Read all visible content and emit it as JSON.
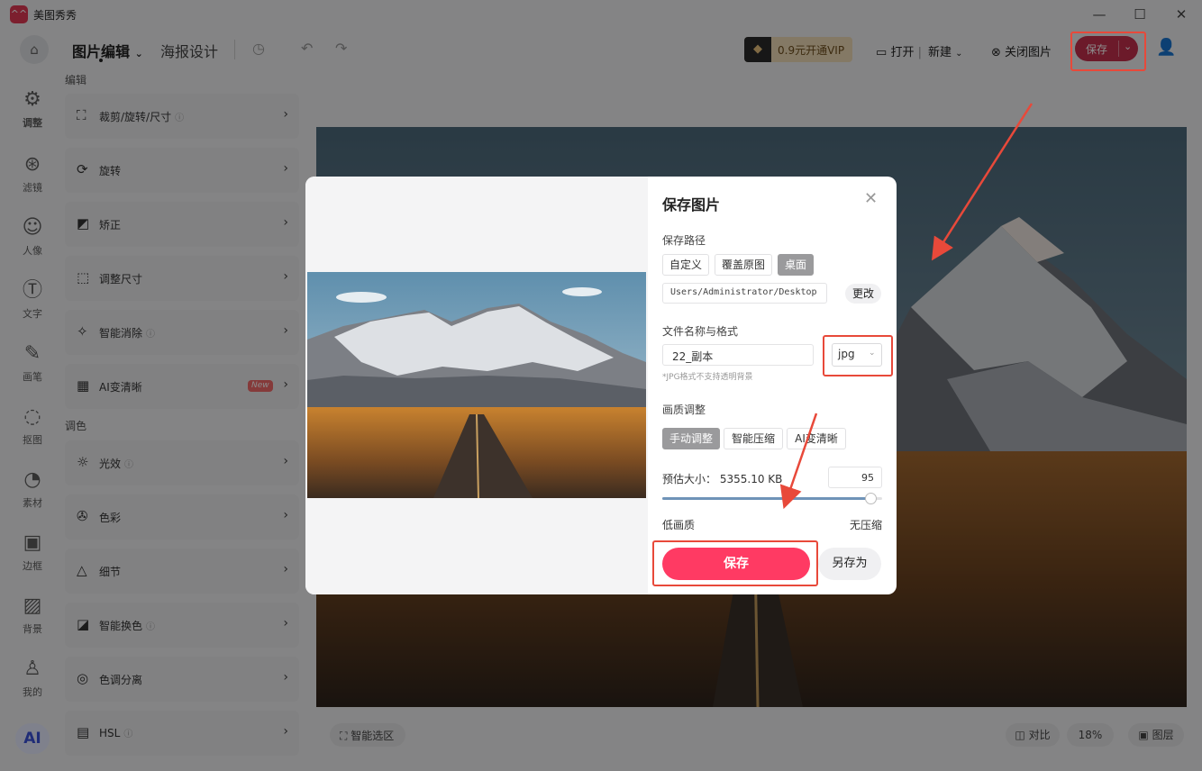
{
  "titlebar": {
    "logo": "^^",
    "app_name": "美图秀秀",
    "minimize_glyph": "—",
    "maximize_glyph": "☐",
    "close_glyph": "✕"
  },
  "toolbar": {
    "home_glyph": "⌂",
    "tab_edit": "图片编辑",
    "tab_poster": "海报设计",
    "history_glyph": "◷",
    "undo_glyph": "↶",
    "redo_glyph": "↷",
    "vip_glyph": "◆",
    "vip_label": "0.9元开通VIP",
    "open_label": "打开",
    "new_label": "新建",
    "close_image_label": "关闭图片",
    "save_label": "保存",
    "save_arrow": "⌄",
    "user_glyph": "👤",
    "accent": "#c5304e"
  },
  "rail": {
    "items": [
      {
        "label": "调整",
        "icon": "⚙"
      },
      {
        "label": "滤镜",
        "icon": "⊛"
      },
      {
        "label": "人像",
        "icon": "☺"
      },
      {
        "label": "文字",
        "icon": "Ⓣ"
      },
      {
        "label": "画笔",
        "icon": "✎"
      },
      {
        "label": "抠图",
        "icon": "◌"
      },
      {
        "label": "素材",
        "icon": "◔"
      },
      {
        "label": "边框",
        "icon": "▣"
      },
      {
        "label": "背景",
        "icon": "▨"
      },
      {
        "label": "我的",
        "icon": "♙"
      }
    ],
    "ai_label": "AI"
  },
  "panel": {
    "section_edit": "编辑",
    "section_color": "调色",
    "help_glyph": "ⓘ",
    "new_badge": "New",
    "chevron": "›",
    "rows": [
      {
        "label": "裁剪/旋转/尺寸",
        "icon": "⛶"
      },
      {
        "label": "旋转",
        "icon": "⟳"
      },
      {
        "label": "矫正",
        "icon": "◩"
      },
      {
        "label": "调整尺寸",
        "icon": "⬚"
      },
      {
        "label": "智能消除",
        "icon": "✧"
      },
      {
        "label": "AI变清晰",
        "icon": "▦"
      },
      {
        "label": "光效",
        "icon": "☼"
      },
      {
        "label": "色彩",
        "icon": "✇"
      },
      {
        "label": "细节",
        "icon": "△"
      },
      {
        "label": "智能换色",
        "icon": "◪"
      },
      {
        "label": "色调分离",
        "icon": "◎"
      },
      {
        "label": "HSL",
        "icon": "▤"
      }
    ]
  },
  "bottom": {
    "smart_select": "智能选区",
    "compare": "对比",
    "zoom": "18%",
    "layers": "图层"
  },
  "dialog": {
    "title": "保存图片",
    "close_glyph": "✕",
    "path_label": "保存路径",
    "path_options": [
      "自定义",
      "覆盖原图",
      "桌面"
    ],
    "path_value": "Users/Administrator/Desktop",
    "change_label": "更改",
    "name_format_label": "文件名称与格式",
    "filename": "22_副本",
    "format": "jpg",
    "format_hint": "*JPG格式不支持透明背景",
    "quality_label": "画质调整",
    "quality_modes": [
      "手动调整",
      "智能压缩",
      "AI变清晰"
    ],
    "estimate_label": "预估大小：",
    "estimate_value": "5355.10 KB",
    "quality_value": "95",
    "quality_fraction": 0.95,
    "low_label": "低画质",
    "lossless_label": "无压缩",
    "save_label": "保存",
    "save_as_label": "另存为",
    "save_color": "#ff3a63"
  },
  "annotation_color": "#e8493a"
}
